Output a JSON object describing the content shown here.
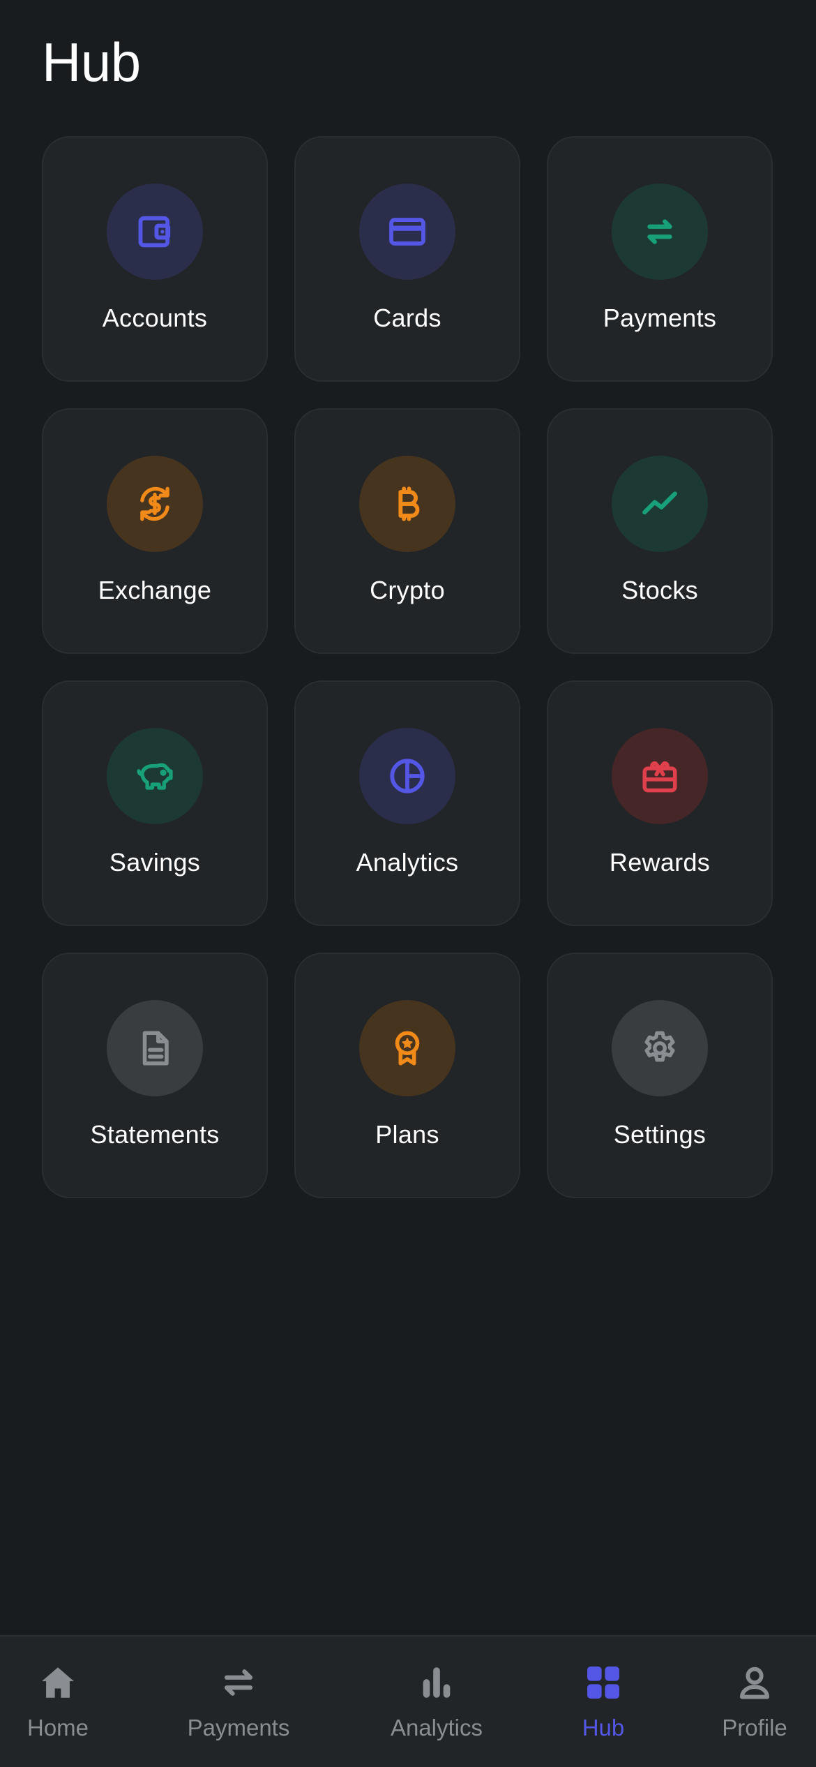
{
  "header": {
    "title": "Hub"
  },
  "tiles": [
    {
      "label": "Accounts",
      "icon": "wallet-icon",
      "color": "#5457e6"
    },
    {
      "label": "Cards",
      "icon": "credit-card-icon",
      "color": "#5457e6"
    },
    {
      "label": "Payments",
      "icon": "transfer-arrows-icon",
      "color": "#18a07a"
    },
    {
      "label": "Exchange",
      "icon": "currency-exchange-icon",
      "color": "#f28a1a"
    },
    {
      "label": "Crypto",
      "icon": "bitcoin-icon",
      "color": "#f28a1a"
    },
    {
      "label": "Stocks",
      "icon": "trending-up-icon",
      "color": "#18a07a"
    },
    {
      "label": "Savings",
      "icon": "piggy-bank-icon",
      "color": "#18a07a"
    },
    {
      "label": "Analytics",
      "icon": "pie-chart-icon",
      "color": "#5457e6"
    },
    {
      "label": "Rewards",
      "icon": "gift-card-icon",
      "color": "#e0404c"
    },
    {
      "label": "Statements",
      "icon": "document-icon",
      "color": "#8a8d91"
    },
    {
      "label": "Plans",
      "icon": "award-badge-icon",
      "color": "#f28a1a"
    },
    {
      "label": "Settings",
      "icon": "gear-icon",
      "color": "#8a8d91"
    }
  ],
  "tabbar": {
    "active": "Hub",
    "items": [
      {
        "label": "Home",
        "icon": "home-icon"
      },
      {
        "label": "Payments",
        "icon": "transfer-arrows-icon"
      },
      {
        "label": "Analytics",
        "icon": "bar-chart-icon"
      },
      {
        "label": "Hub",
        "icon": "grid-icon"
      },
      {
        "label": "Profile",
        "icon": "person-icon"
      }
    ]
  },
  "colors": {
    "background": "#191c1f",
    "tile": "#222528",
    "accent": "#5457e6",
    "inactive": "#8a8d91"
  }
}
